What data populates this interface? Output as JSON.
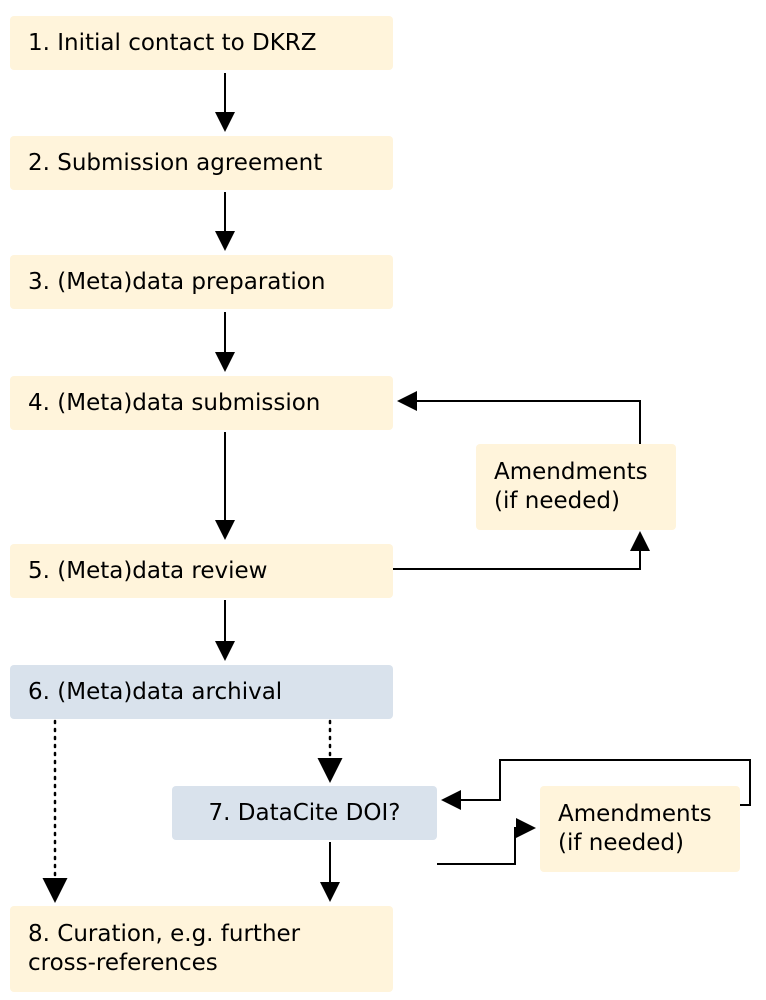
{
  "steps": {
    "s1": "1. Initial contact to DKRZ",
    "s2": "2. Submission agreement",
    "s3": "3. (Meta)data preparation",
    "s4": "4. (Meta)data submission",
    "s5": "5. (Meta)data review",
    "s6": "6. (Meta)data archival",
    "s7": "7. DataCite DOI?",
    "s8a": "8. Curation, e.g. further",
    "s8b": "cross-references",
    "amend1a": "Amendments",
    "amend1b": "(if needed)",
    "amend2a": "Amendments",
    "amend2b": "(if needed)"
  }
}
